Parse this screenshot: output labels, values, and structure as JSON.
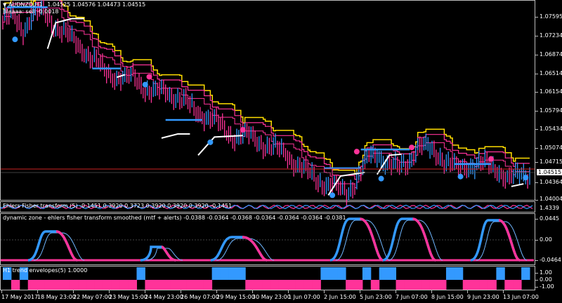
{
  "header": {
    "symbol": "AUDNZD,H1",
    "ohlc": "1.04525 1.04576 1.04473 1.04515",
    "subtitle": "Blaaaa: sell -0.0018"
  },
  "price_scale": {
    "labels": [
      "1.07595",
      "1.07234",
      "1.06874",
      "1.06514",
      "1.06154",
      "1.05794",
      "1.05434",
      "1.05074",
      "1.04715",
      "1.04364",
      "1.04004"
    ],
    "current_price": "1.04515"
  },
  "indicator1": {
    "title": "Ehlers Fisher transform (5) -0.1451 0.3920 0.3723 0.3920 0.3920 0.3920 -0.1451",
    "scale_labels": [
      "1.4339"
    ]
  },
  "indicator2": {
    "title": "dynamic zone - ehlers fisher transform smoothed (mtf + alerts) -0.0388 -0.0364 -0.0368 -0.0364 -0.0364 -0.0364 -0.0381",
    "scale_labels": [
      "0.0445",
      "0.00",
      "-0.0464"
    ]
  },
  "indicator3": {
    "title": "H1 trend envelopes(5) 1.0000",
    "scale_labels": [
      "1.00",
      "0.00",
      "-1.00"
    ]
  },
  "time_axis": [
    "17 May 2017",
    "18 May 23:00",
    "22 May 07:00",
    "23 May 15:00",
    "24 May 23:00",
    "26 May 07:00",
    "29 May 15:00",
    "30 May 23:00",
    "1 Jun 07:00",
    "2 Jun 15:00",
    "5 Jun 23:00",
    "7 Jun 07:00",
    "8 Jun 15:00",
    "9 Jun 23:00",
    "13 Jun 07:00"
  ],
  "colors": {
    "background": "#000000",
    "bull": "#3399ff",
    "bear": "#ff3399",
    "band_yellow": "#ffdd00",
    "band_magenta": "#ff3399",
    "signal_white": "#ffffff",
    "current_line": "#cc2222"
  },
  "chart_data": {
    "type": "line",
    "title": "AUDNZD,H1",
    "price_range": [
      1.04004,
      1.07595
    ],
    "close": [
      1.0745,
      1.0752,
      1.0728,
      1.0756,
      1.076,
      1.0741,
      1.0722,
      1.0705,
      1.069,
      1.0668,
      1.0648,
      1.064,
      1.0631,
      1.0636,
      1.0617,
      1.0604,
      1.0608,
      1.0602,
      1.0587,
      1.057,
      1.0563,
      1.055,
      1.0532,
      1.0522,
      1.0523,
      1.0516,
      1.0506,
      1.0496,
      1.0488,
      1.047,
      1.0452,
      1.044,
      1.0431,
      1.042,
      1.0415,
      1.0441,
      1.0478,
      1.049,
      1.047,
      1.0458,
      1.0473,
      1.0505,
      1.0496,
      1.0489,
      1.0471,
      1.0456,
      1.0468,
      1.047,
      1.0464,
      1.0458,
      1.044,
      1.0445,
      1.0451
    ],
    "trend_envelope": [
      1,
      -1,
      1,
      -1,
      -1,
      -1,
      -1,
      -1,
      -1,
      -1,
      -1,
      -1,
      -1,
      -1,
      -1,
      -1,
      1,
      -1,
      -1,
      -1,
      -1,
      -1,
      -1,
      -1,
      -1,
      1,
      1,
      1,
      1,
      -1,
      -1,
      -1,
      -1,
      -1,
      -1,
      -1,
      -1,
      -1,
      1,
      1,
      1,
      -1,
      -1,
      1,
      -1,
      1,
      1,
      -1,
      -1,
      -1,
      -1,
      -1,
      -1,
      1,
      1,
      -1,
      -1,
      -1,
      -1,
      1,
      -1,
      -1,
      1
    ]
  }
}
